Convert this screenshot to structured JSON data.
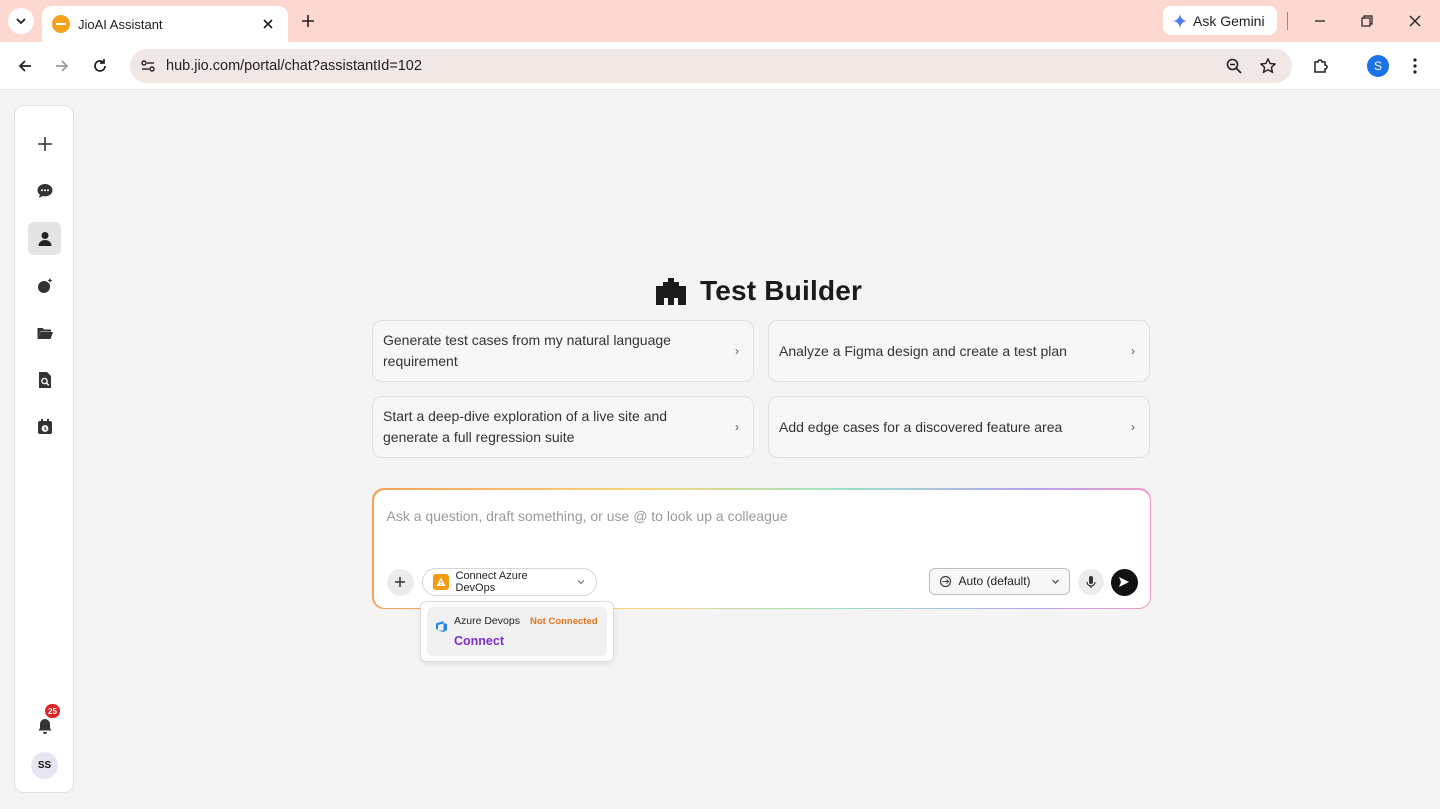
{
  "browser": {
    "tab_title": "JioAI Assistant",
    "url": "hub.jio.com/portal/chat?assistantId=102",
    "gemini_label": "Ask Gemini",
    "profile_initial": "S"
  },
  "sidebar": {
    "notification_count": "25",
    "user_initials": "SS"
  },
  "main": {
    "title": "Test Builder",
    "suggestions": [
      {
        "text": "Generate test cases from my natural language requirement"
      },
      {
        "text": "Analyze a Figma design and create a test plan"
      },
      {
        "text": "Start a deep-dive exploration of a live site and generate a full regression suite"
      },
      {
        "text": "Add edge cases for a discovered feature area"
      }
    ],
    "chevron": "›"
  },
  "composer": {
    "placeholder": "Ask a question, draft something, or use @ to look up a colleague",
    "connect_chip": "Connect Azure DevOps",
    "model": "Auto (default)"
  },
  "dropdown": {
    "service_name": "Azure Devops",
    "status": "Not Connected",
    "action": "Connect"
  },
  "colors": {
    "tabstrip": "#fdd8d1",
    "accent_purple": "#7a2ed0",
    "status_orange": "#e8731a",
    "badge_red": "#e02424"
  }
}
